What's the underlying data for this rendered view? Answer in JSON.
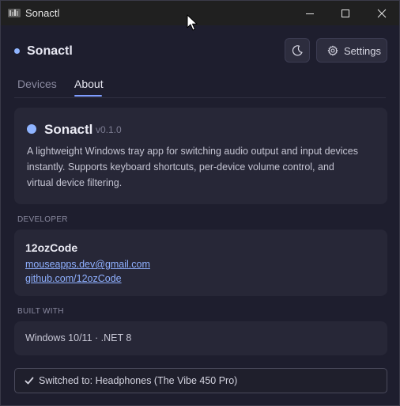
{
  "window": {
    "title": "Sonactl"
  },
  "header": {
    "app_name": "Sonactl",
    "settings_label": "Settings"
  },
  "tabs": [
    {
      "label": "Devices",
      "active": false
    },
    {
      "label": "About",
      "active": true
    }
  ],
  "about": {
    "name": "Sonactl",
    "version": "v0.1.0",
    "description": "A lightweight Windows tray app for switching audio output and input devices instantly. Supports keyboard shortcuts, per-device volume control, and virtual device filtering."
  },
  "developer": {
    "section_label": "DEVELOPER",
    "name": "12ozCode",
    "email": "mouseapps.dev@gmail.com",
    "github": "github.com/12ozCode"
  },
  "built_with": {
    "section_label": "BUILT WITH",
    "text": "Windows 10/11 · .NET 8"
  },
  "status": {
    "text": "Switched to: Headphones (The Vibe 450 Pro)"
  },
  "icons": {
    "app": "app-logo-icon",
    "theme": "moon-icon",
    "settings": "gear-icon",
    "status": "checkmark-icon"
  },
  "colors": {
    "accent": "#8fb4ff",
    "tab_underline": "#7f9dff",
    "background": "#1e1e2e",
    "card": "#272737",
    "link": "#8fb0ff"
  }
}
